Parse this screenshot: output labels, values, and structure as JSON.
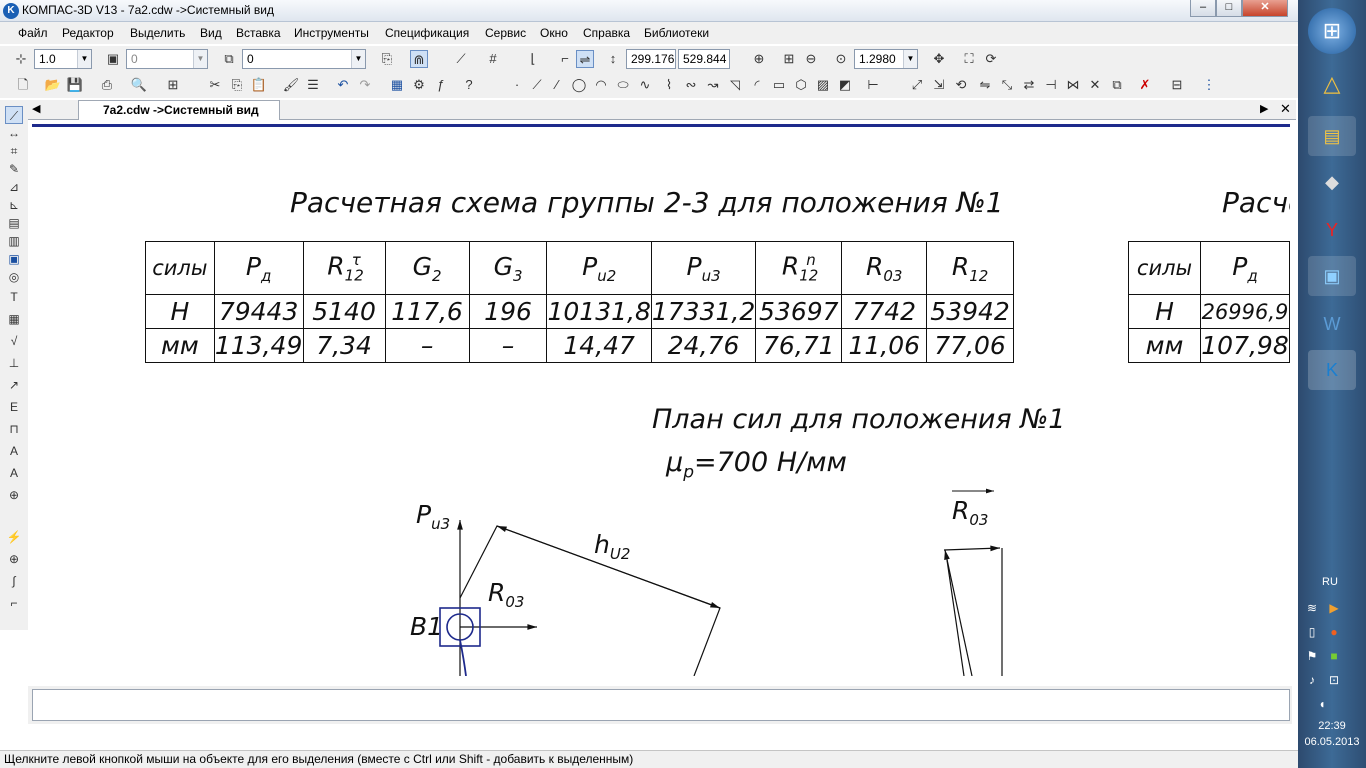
{
  "window": {
    "title": "КОМПАС-3D V13 - 7a2.cdw ->Системный вид",
    "app_icon": "K",
    "min": "–",
    "max": "□",
    "close": "✕"
  },
  "menu": [
    "Файл",
    "Редактор",
    "Выделить",
    "Вид",
    "Вставка",
    "Инструменты",
    "Спецификация",
    "Сервис",
    "Окно",
    "Справка",
    "Библиотеки"
  ],
  "toolbar1": {
    "scale": "1.0",
    "layer": "0",
    "style": "0",
    "coord_x": "299.176",
    "coord_y": "529.844",
    "zoom": "1.2980"
  },
  "tab": {
    "label": "7a2.cdw ->Системный вид"
  },
  "drawing": {
    "title_left": "Расчетная схема группы 2-3 для положения №1",
    "title_right": "Расче",
    "table_left": {
      "header": [
        "силы",
        "Pд",
        "R12τ",
        "G2",
        "G3",
        "Pu2",
        "Pu3",
        "R12n",
        "R03",
        "R12"
      ],
      "row_h": [
        "Н",
        "79443",
        "5140",
        "117,6",
        "196",
        "10131,8",
        "17331,2",
        "53697",
        "7742",
        "53942"
      ],
      "row_mm": [
        "мм",
        "113,49",
        "7,34",
        "–",
        "–",
        "14,47",
        "24,76",
        "76,71",
        "11,06",
        "77,06"
      ]
    },
    "table_right": {
      "header": [
        "силы",
        "Pд"
      ],
      "row_h": [
        "Н",
        "26996,9"
      ],
      "row_mm": [
        "мм",
        "107,98"
      ]
    },
    "plan_title": "План сил для положения №1",
    "mu_label": "μ",
    "mu_sub": "p",
    "mu_value": "=700 Н/мм",
    "labels": {
      "pu3": "P",
      "pu3_sub": "u3",
      "r03": "R",
      "r03_sub": "03",
      "h": "h",
      "h_sub": "U2",
      "b1": "B1",
      "r03_right": "R",
      "r03_right_sub": "03"
    }
  },
  "status": {
    "text": "Щелкните левой кнопкой мыши на объекте для его выделения (вместе с Ctrl или Shift - добавить к выделенным)"
  },
  "taskbar": {
    "lang": "RU",
    "time": "22:39",
    "date": "06.05.2013"
  }
}
